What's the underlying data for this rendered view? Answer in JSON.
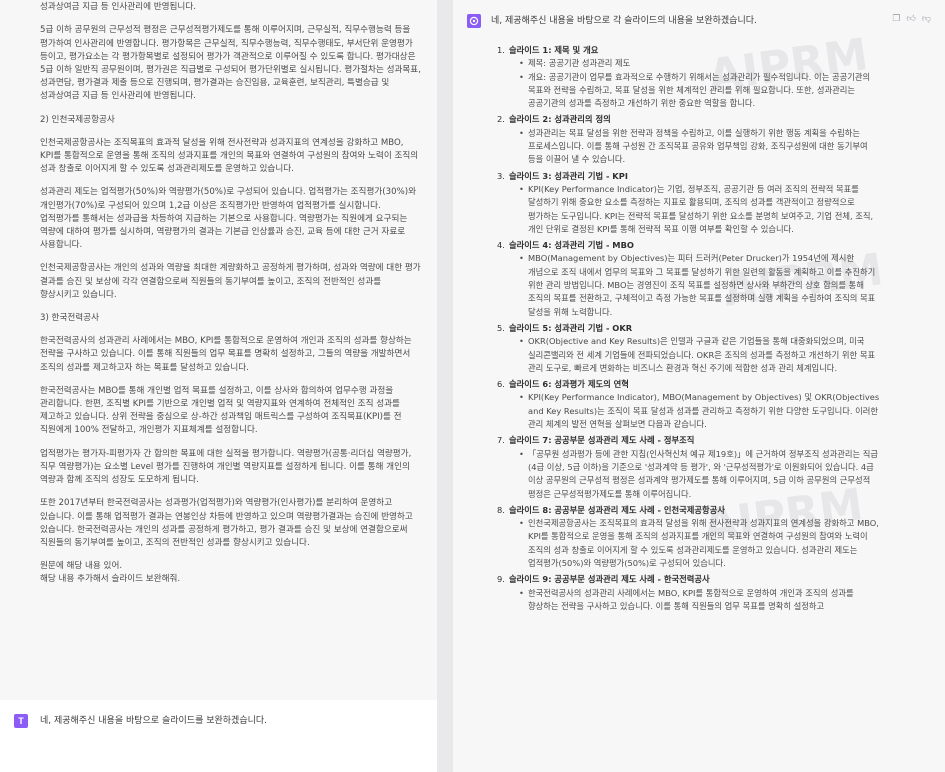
{
  "left": {
    "paragraphs": [
      "평가, 결과공개 및 이의신청 등으로 이루어지며, 평가결과는 승진임용, 교육훈련, 보직관리, 특별승급 및 성과상여금 지급 등 인사관리에 반영됩니다.",
      "5급 이하 공무원의 근무성적 평정은 근무성적평가제도를 통해 이루어지며, 근무실적, 직무수행능력 등을 평가하여 인사관리에 반영합니다. 평가항목은 근무실적, 직무수행능력, 직무수행태도, 부서단위 운영평가 등이고, 평가요소는 각 평가항목별로 설정되어 평가가 객관적으로 이루어질 수 있도록 합니다. 평가대상은 5급 이하 일반직 공무원이며, 평가권은 직급별로 구성되어 평가단위별로 실시됩니다. 평가절차는 성과목표, 성과면담, 평가결과 제출 등으로 진행되며, 평가결과는 승진임용, 교육훈련, 보직관리, 특별승급 및 성과상여금 지급 등 인사관리에 반영됩니다.",
      "2) 인천국제공항공사",
      "인천국제공항공사는 조직목표의 효과적 달성을 위해 전사전략과 성과지표의 연계성을 강화하고 MBO, KPI를 통합적으로 운영을 통해 조직의 성과지표를 개인의 목표와 연결하여 구성원의 참여와 노력이 조직의 성과 창출로 이어지게 할 수 있도록 성과관리제도를 운영하고 있습니다.",
      "성과관리 제도는 업적평가(50%)와 역량평가(50%)로 구성되어 있습니다. 업적평가는 조직평가(30%)와 개인평가(70%)로 구성되어 있으며 1,2급 이상은 조직평가만 반영하여 업적평가를 실시합니다. 업적평가를 통해서는 성과급을 차등하여 지급하는 기본으로 사용합니다. 역량평가는 직원에게 요구되는 역량에 대하여 평가를 실시하며, 역량평가의 결과는 기본급 인상률과 승진, 교육 등에 대한 근거 자료로 사용합니다.",
      "인천국제공항공사는 개인의 성과와 역량을 최대한 계량화하고 공정하게 평가하며, 성과와 역량에 대한 평가 결과를 승진 및 보상에 각각 연결함으로써 직원들의 동기부여를 높이고, 조직의 전반적인 성과를 향상시키고 있습니다.",
      "3) 한국전력공사",
      "한국전력공사의 성과관리 사례에서는 MBO, KPI를 통합적으로 운영하여 개인과 조직의 성과를 향상하는 전략을 구사하고 있습니다. 이를 통해 직원들의 업무 목표를 명확히 설정하고, 그들의 역량을 개발하면서 조직의 성과를 제고하고자 하는 목표를 달성하고 있습니다.",
      "한국전력공사는 MBO를 통해 개인별 업적 목표를 설정하고, 이를 상사와 합의하여 업무수행 과정을 관리합니다. 한편, 조직별 KPI를 기반으로 개인별 업적 및 역량지표와 연계하여 전체적인 조직 성과를 제고하고 있습니다. 상위 전략을 중심으로 상-하간 성과책임 매트릭스를 구성하여 조직목표(KPI)를 전 직원에게 100% 전달하고, 개인평가 지표체계를 설정합니다.",
      "업적평가는 평가자-피평가자 간 합의한 목표에 대한 실적을 평가합니다. 역량평가(공통·리더십 역량평가, 직무 역량평가)는 요소별 Level 평가를 진행하여 개인별 역량지표를 설정하게 됩니다. 이를 통해 개인의 역량과 함께 조직의 성장도 도모하게 됩니다.",
      "또한 2017년부터 한국전력공사는 성과평가(업적평가)와 역량평가(인사평가)를 분리하여 운영하고 있습니다. 이를 통해 업적평가 결과는 연봉인상 차등에 반영하고 있으며 역량평가결과는 승진에 반영하고 있습니다. 한국전력공사는 개인의 성과를 공정하게 평가하고, 평가 결과를 승진 및 보상에 연결함으로써 직원들의 동기부여를 높이고, 조직의 전반적인 성과를 향상시키고 있습니다.",
      "원문에 해당 내용 있어.\n해당 내용 추가해서 슬라이드 보완해줘."
    ],
    "bottom_avatar": "T",
    "bottom_message": "네, 제공해주신 내용을 바탕으로 슬라이드를 보완하겠습니다."
  },
  "right": {
    "intro": "네, 제공해주신 내용을 바탕으로 각 슬라이드의 내용을 보완하겠습니다.",
    "watermark": "AIPRM",
    "slides": [
      {
        "num": "1.",
        "title": "슬라이드 1: 제목 및 개요",
        "bullets": [
          "제목: 공공기관 성과관리 제도",
          "개요: 공공기관이 업무를 효과적으로 수행하기 위해서는 성과관리가 필수적입니다. 이는 공공기관의 목표와 전략을 수립하고, 목표 달성을 위한 체계적인 관리를 위해 필요합니다. 또한, 성과관리는 공공기관의 성과를 측정하고 개선하기 위한 중요한 역할을 합니다."
        ]
      },
      {
        "num": "2.",
        "title": "슬라이드 2: 성과관리의 정의",
        "bullets": [
          "성과관리는 목표 달성을 위한 전략과 정책을 수립하고, 이를 실행하기 위한 행동 계획을 수립하는 프로세스입니다. 이를 통해 구성원 간 조직목표 공유와 업무책임 강화, 조직구성원에 대한 동기부여 등을 이끌어 낼 수 있습니다."
        ]
      },
      {
        "num": "3.",
        "title": "슬라이드 3: 성과관리 기법 - KPI",
        "bullets": [
          "KPI(Key Performance Indicator)는 기업, 정부조직, 공공기관 등 여러 조직의 전략적 목표를 달성하기 위해 중요한 요소를 측정하는 지표로 활용되며, 조직의 성과를 객관적이고 정량적으로 평가하는 도구입니다. KPI는 전략적 목표를 달성하기 위한 요소를 분명히 보여주고, 기업 전체, 조직, 개인 단위로 결정된 KPI를 통해 전략적 목표 이행 여부를 확인할 수 있습니다."
        ]
      },
      {
        "num": "4.",
        "title": "슬라이드 4: 성과관리 기법 - MBO",
        "bullets": [
          "MBO(Management by Objectives)는 피터 드러커(Peter Drucker)가 1954년에 제시한 개념으로 조직 내에서 업무의 목표와 그 목표를 달성하기 위한 일련의 활동을 계획하고 이를 추진하기 위한 관리 방법입니다. MBO는 경영진이 조직 목표를 설정하면 상사와 부하간의 상호 합의를 통해 조직의 목표를 전환하고, 구체적이고 측정 가능한 목표를 설정하며 실행 계획을 수립하여 조직의 목표 달성을 위해 노력합니다."
        ]
      },
      {
        "num": "5.",
        "title": "슬라이드 5: 성과관리 기법 - OKR",
        "bullets": [
          "OKR(Objective and Key Results)은 인텔과 구글과 같은 기업들을 통해 대중화되었으며, 미국 실리콘밸리와 전 세계 기업들에 전파되었습니다. OKR은 조직의 성과를 측정하고 개선하기 위한 목표 관리 도구로, 빠르게 변화하는 비즈니스 환경과 혁신 주기에 적합한 성과 관리 체계입니다."
        ]
      },
      {
        "num": "6.",
        "title": "슬라이드 6: 성과평가 제도의 연혁",
        "bullets": [
          "KPI(Key Performance Indicator), MBO(Management by Objectives) 및 OKR(Objectives and Key Results)는 조직이 목표 달성과 성과를 관리하고 측정하기 위한 다양한 도구입니다. 이러한 관리 체계의 발전 연혁을 살펴보면 다음과 같습니다."
        ]
      },
      {
        "num": "7.",
        "title": "슬라이드 7: 공공부문 성과관리 제도 사례 - 정부조직",
        "bullets": [
          "「공무원 성과평가 등에 관한 지침(인사혁신처 예규 제19호)」에 근거하여 정부조직 성과관리는 직급(4급 이상, 5급 이하)을 기준으로 '성과계약 등 평가', 와 '근무성적평가'로 이원화되어 있습니다. 4급 이상 공무원의 근무성적 평정은 성과계약 평가제도를 통해 이루어지며, 5급 이하 공무원의 근무성적 평정은 근무성적평가제도를 통해 이루어집니다."
        ]
      },
      {
        "num": "8.",
        "title": "슬라이드 8: 공공부문 성과관리 제도 사례 - 인천국제공항공사",
        "bullets": [
          "인천국제공항공사는 조직목표의 효과적 달성을 위해 전사전략과 성과지표의 연계성을 강화하고 MBO, KPI를 통합적으로 운영을 통해 조직의 성과지표를 개인의 목표와 연결하여 구성원의 참여와 노력이 조직의 성과 창출로 이어지게 할 수 있도록 성과관리제도를 운영하고 있습니다. 성과관리 제도는 업적평가(50%)와 역량평가(50%)로 구성되어 있습니다."
        ]
      },
      {
        "num": "9.",
        "title": "슬라이드 9: 공공부문 성과관리 제도 사례 - 한국전력공사",
        "bullets": [
          "한국전력공사의 성과관리 사례에서는 MBO, KPI를 통합적으로 운영하여 개인과 조직의 성과를 향상하는 전략을 구사하고 있습니다. 이를 통해 직원들의 업무 목표를 명확히 설정하고"
        ]
      }
    ]
  }
}
